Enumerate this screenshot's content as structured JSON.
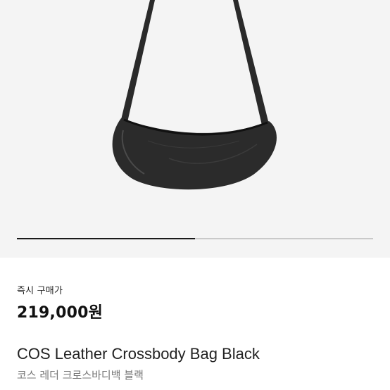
{
  "product": {
    "image_alt_icon": "bag-photo",
    "carousel_progress": 0.5,
    "purchase_label": "즉시 구매가",
    "price": "219,000원",
    "title": "COS Leather Crossbody Bag Black",
    "subtitle": "코스 레더 크로스바디백 블랙"
  },
  "colors": {
    "hero_bg": "#f4f4f4",
    "bag": "#2b2b2b",
    "progress_fill": "#1a1a1a",
    "progress_track": "#c9c9c9",
    "subtitle_text": "#777777"
  }
}
